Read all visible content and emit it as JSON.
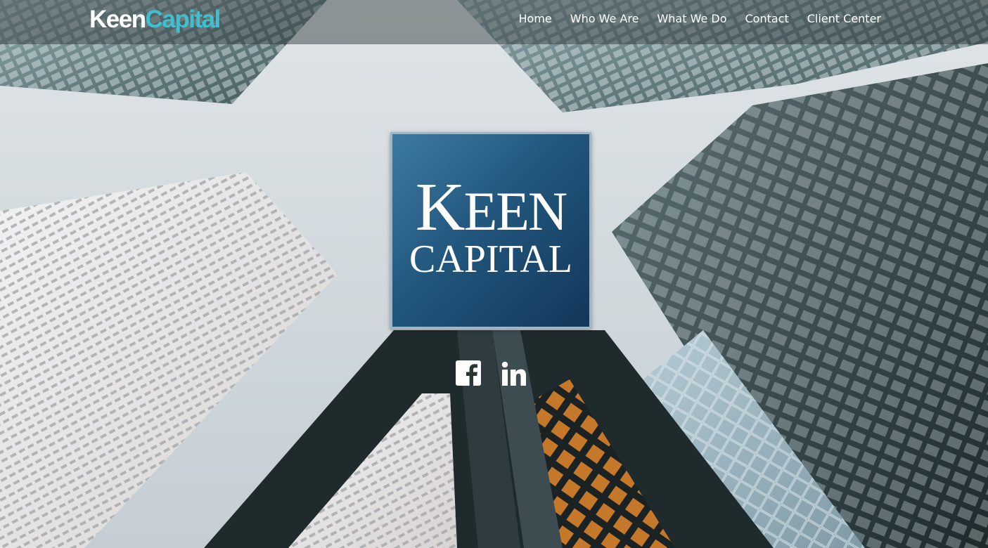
{
  "header": {
    "brand": {
      "part1": "Keen",
      "part2": "Capital"
    },
    "nav": [
      {
        "label": "Home"
      },
      {
        "label": "Who We Are"
      },
      {
        "label": "What We Do"
      },
      {
        "label": "Contact"
      },
      {
        "label": "Client Center"
      }
    ]
  },
  "hero": {
    "logo_line1_first": "K",
    "logo_line1_rest": "EEN",
    "logo_line2": "CAPITAL"
  },
  "social": [
    {
      "icon": "facebook-icon"
    },
    {
      "icon": "linkedin-icon"
    }
  ],
  "colors": {
    "brand_accent": "#3fc0d0",
    "logo_blue": "#22577d",
    "nav_text": "#ffffff"
  }
}
